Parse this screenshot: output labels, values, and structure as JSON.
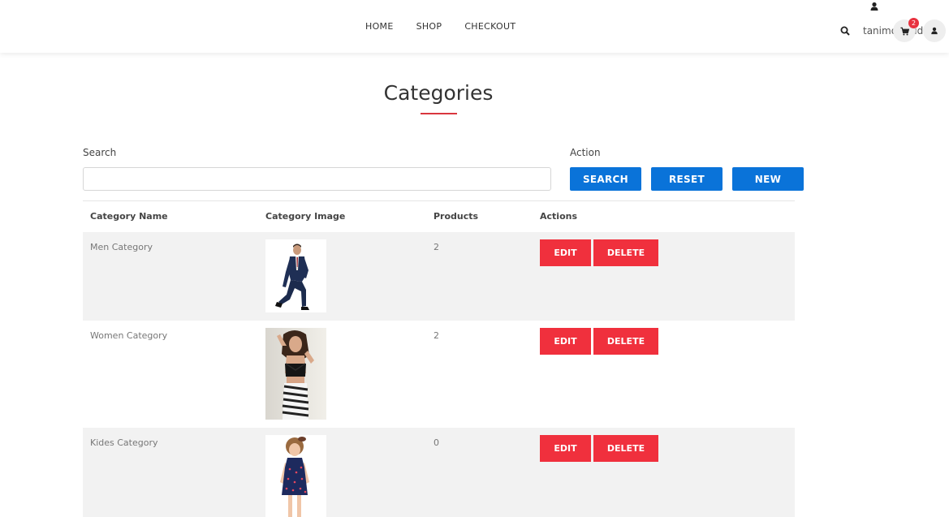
{
  "nav": {
    "items": [
      {
        "label": "HOME"
      },
      {
        "label": "SHOP"
      },
      {
        "label": "CHECKOUT"
      }
    ]
  },
  "header": {
    "username": "tanimoshaidi",
    "cart_count": "2",
    "icons": {
      "search": "search-icon",
      "cart": "cart-icon",
      "user": "user-icon"
    }
  },
  "page": {
    "title": "Categories",
    "accent_color": "#d9363e"
  },
  "search": {
    "label": "Search",
    "value": "",
    "placeholder": ""
  },
  "actions": {
    "label": "Action",
    "search_label": "SEARCH",
    "reset_label": "RESET",
    "new_label": "NEW",
    "button_color": "#0a73d9"
  },
  "table": {
    "columns": [
      "Category Name",
      "Category Image",
      "Products",
      "Actions"
    ],
    "rows": [
      {
        "name": "Men Category",
        "products": "2",
        "edit_label": "EDIT",
        "delete_label": "DELETE",
        "image": "man-in-suit-photo"
      },
      {
        "name": "Women Category",
        "products": "2",
        "edit_label": "EDIT",
        "delete_label": "DELETE",
        "image": "woman-fashion-photo"
      },
      {
        "name": "Kides Category",
        "products": "0",
        "edit_label": "EDIT",
        "delete_label": "DELETE",
        "image": "child-fashion-photo"
      }
    ],
    "action_color": "#f0303d"
  }
}
